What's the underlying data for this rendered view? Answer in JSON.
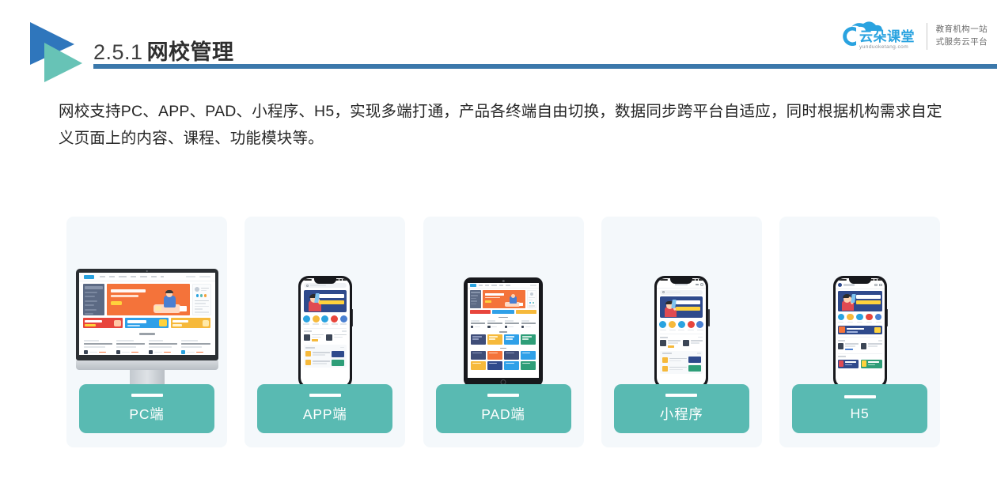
{
  "header": {
    "section_number": "2.5.1",
    "title_cn": "网校管理",
    "rule_color": "#3b78ab",
    "logo_blue": "#2f76bc",
    "logo_teal": "#67c3b6"
  },
  "brand": {
    "name_cn": "云朵课堂",
    "name_en": "yunduoketang.com",
    "tagline_line1": "教育机构一站",
    "tagline_line2": "式服务云平台",
    "color": "#2aa3e0"
  },
  "body": {
    "paragraph": "网校支持PC、APP、PAD、小程序、H5，实现多端打通，产品各终端自由切换，数据同步跨平台自适应，同时根据机构需求自定义页面上的内容、课程、功能模块等。"
  },
  "cards": [
    {
      "id": "pc",
      "label": "PC端",
      "device": "monitor"
    },
    {
      "id": "app",
      "label": "APP端",
      "device": "phone"
    },
    {
      "id": "pad",
      "label": "PAD端",
      "device": "tablet"
    },
    {
      "id": "mini",
      "label": "小程序",
      "device": "phone-mini"
    },
    {
      "id": "h5",
      "label": "H5",
      "device": "phone-h5"
    }
  ],
  "theme": {
    "button_teal": "#59bab2",
    "card_bg": "#f4f8fb",
    "banner_orange": "#f4733a",
    "banner_blue": "#2f4a8c",
    "text_dark": "#262626"
  }
}
